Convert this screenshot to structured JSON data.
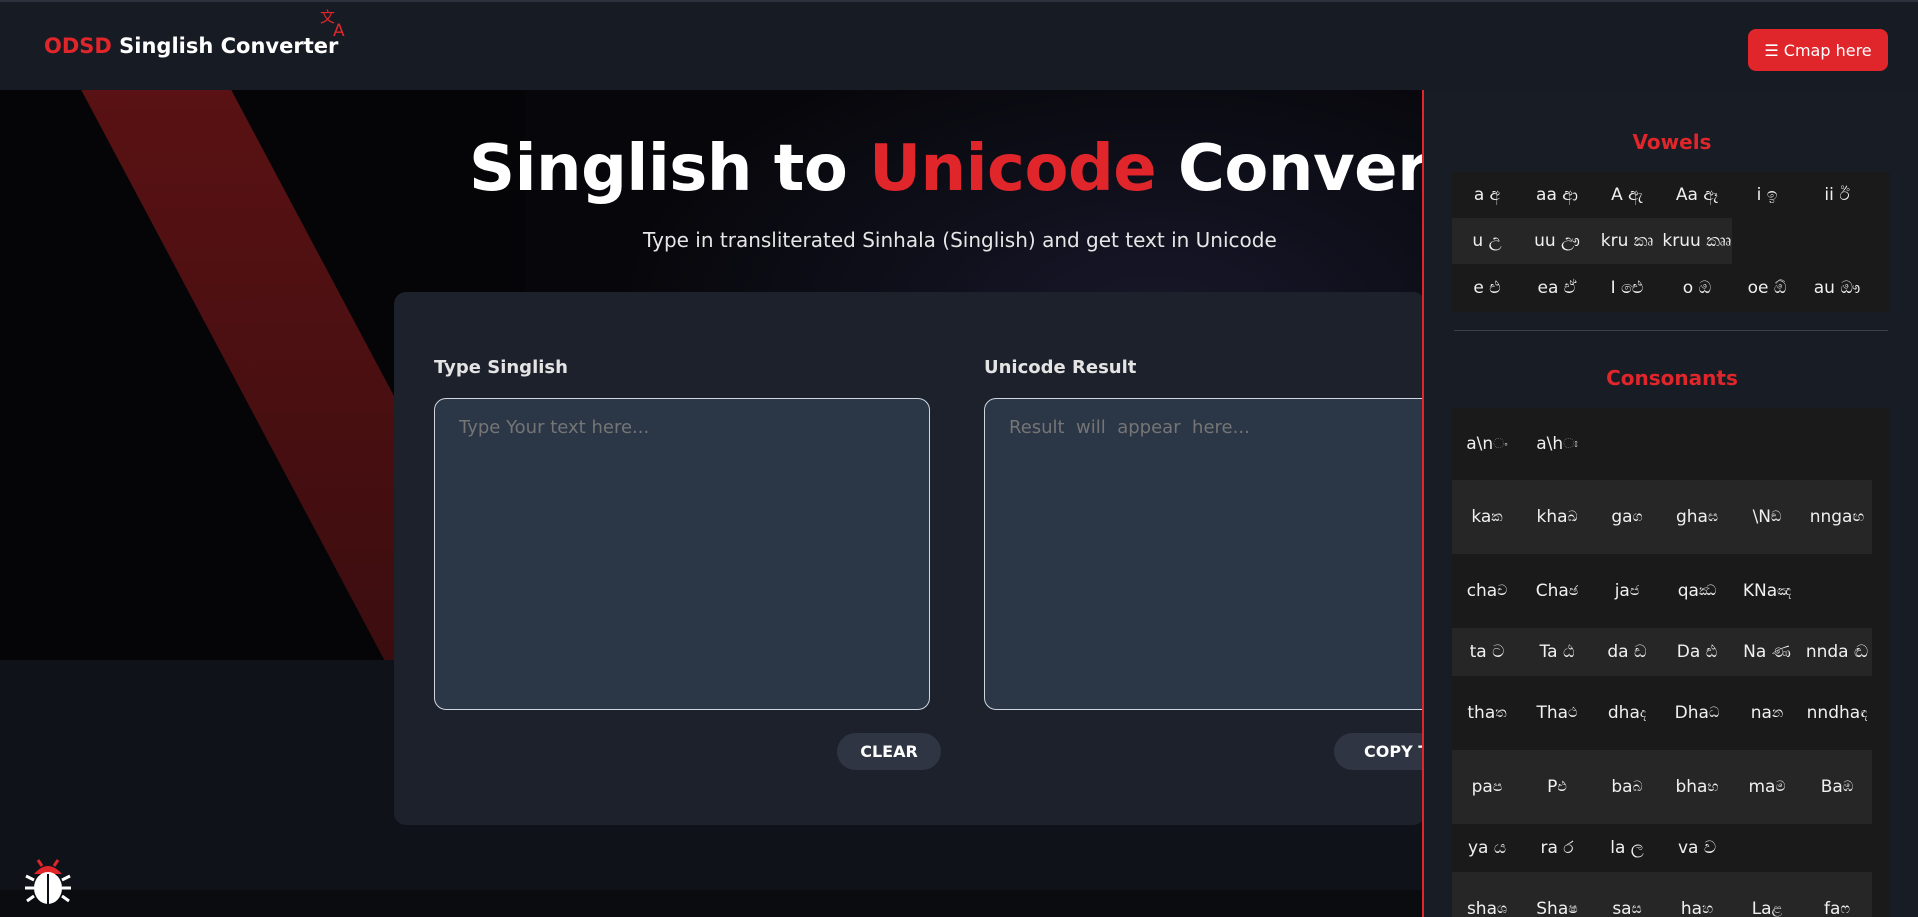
{
  "header": {
    "brand_accent": "ODSD",
    "brand_rest": "Singlish Converter",
    "translate_icon": "translate-icon",
    "cmap_button": "☰ Cmap here"
  },
  "hero": {
    "title_part1": "Singlish to ",
    "title_accent": "Unicode",
    "title_part2": " Converter",
    "subtitle": "Type in transliterated Sinhala (Singlish) and get text in Unicode"
  },
  "converter": {
    "input_label": "Type Singlish",
    "input_placeholder": "Type Your text here...",
    "input_value": "",
    "output_label": "Unicode Result",
    "output_placeholder": "Result  will  appear  here...",
    "output_value": "",
    "clear_button": "CLEAR",
    "copy_button": "COPY T"
  },
  "sidebar": {
    "vowels_title": "Vowels",
    "consonants_title": "Consonants",
    "vowels": [
      "a අ",
      "aa ආ",
      "A ඇ",
      "Aa ඈ",
      "i ඉ",
      "ii ඊ",
      "u උ",
      "uu ඌ",
      "kru කෘ",
      "kruu කෲ",
      "e එ",
      "ea ඒ",
      "I ඓ",
      "o ඔ",
      "oe ඕ",
      "au ඖ"
    ],
    "consonants": [
      "a\\n ං",
      "a\\h ඃ",
      "ka ක",
      "kha ඛ",
      "ga ග",
      "gha ඝ",
      "\\N ඞ",
      "nnga ඟ",
      "cha ච",
      "Cha ඡ",
      "ja ජ",
      "qa ඣ",
      "KNa ඤ",
      "ta ට",
      "Ta ඨ",
      "da ඩ",
      "Da ඪ",
      "Na ණ",
      "nnda ඬ",
      "tha ත",
      "Tha ථ",
      "dha ද",
      "Dha ධ",
      "na න",
      "nndha ඳ",
      "pa ප",
      "P ඵ",
      "ba බ",
      "bha භ",
      "ma ම",
      "Ba ඹ",
      "ya ය",
      "ra ර",
      "la ල",
      "va ව",
      "sha ශ",
      "Sha ෂ",
      "sa ස",
      "ha හ",
      "La ළ",
      "fa ෆ"
    ]
  },
  "colors": {
    "accent": "#e0262b",
    "header_bg": "#171b24",
    "card_bg": "#1c212b",
    "sidebar_bg": "#181c24"
  },
  "icons": {
    "bug": "bug-icon",
    "menu": "menu-icon"
  }
}
